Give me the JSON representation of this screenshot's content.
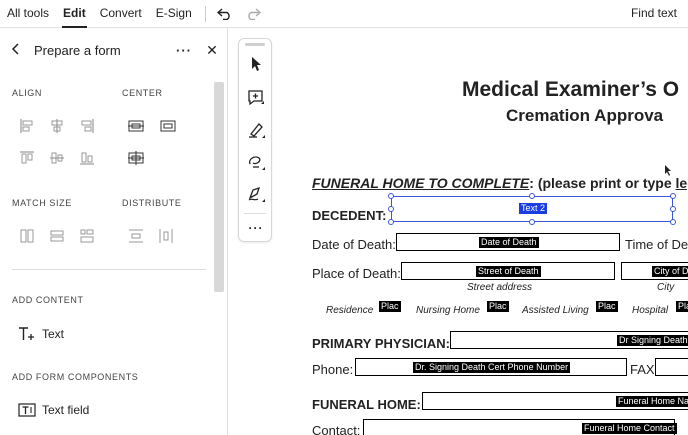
{
  "menubar": {
    "items": [
      "All tools",
      "Edit",
      "Convert",
      "E-Sign"
    ],
    "active": "Edit",
    "find": "Find text"
  },
  "panel": {
    "title": "Prepare a form",
    "align_label": "ALIGN",
    "center_label": "CENTER",
    "match_size_label": "MATCH SIZE",
    "distribute_label": "DISTRIBUTE",
    "add_content_label": "ADD CONTENT",
    "text_item": "Text",
    "add_form_label": "ADD FORM COMPONENTS",
    "text_field_item": "Text field"
  },
  "doc": {
    "title": "Medical Examiner’s O",
    "subtitle": "Cremation Approva",
    "funeral_heading": "FUNERAL HOME TO COMPLETE",
    "funeral_note": ":  (please print or type ",
    "funeral_note_end": "legib",
    "decedent": "DECEDENT:",
    "text2": "Text 2",
    "date_of_death": "Date of Death:",
    "date_of_death_tag": "Date of Death",
    "time_of": "Time of De",
    "place_of_death": "Place of Death:",
    "street_tag": "Street of Death",
    "city_tag": "City of De",
    "street_address": "Street address",
    "city": "City",
    "residence": "Residence",
    "nursing_home": "Nursing Home",
    "assisted_living": "Assisted Living",
    "hospital": "Hospital",
    "plac": "Plac",
    "plac_short": "Pla",
    "primary_physician": "PRIMARY PHYSICIAN:",
    "dr_tag": "Dr Signing Death",
    "phone": "Phone:",
    "phone_tag": "Dr. Signing Death Cert Phone Number",
    "fax": "FAX",
    "funeral_home": "FUNERAL HOME:",
    "funeral_home_tag": "Funeral Home Na",
    "contact": "Contact:",
    "contact_tag": "Funeral Home Contact"
  }
}
